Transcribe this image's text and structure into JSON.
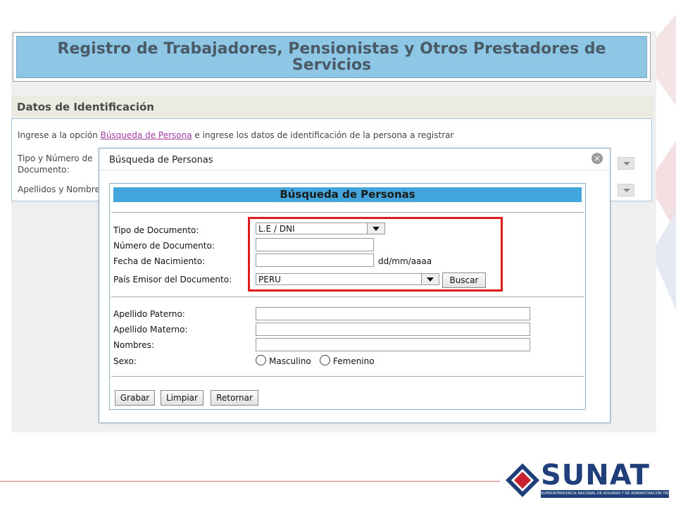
{
  "page": {
    "title": "Registro de Trabajadores, Pensionistas y Otros Prestadores de Servicios",
    "section_title": "Datos de Identificación",
    "intro_before": "Ingrese a la opción ",
    "intro_link": "Búsqueda de Persona",
    "intro_after": " e ingrese los datos de identificación de la persona a registrar",
    "label_tipo_numero": "Tipo y Número de Documento:",
    "label_apellidos": "Apellidos y Nombre"
  },
  "dialog": {
    "title": "Búsqueda de Personas",
    "header": "Búsqueda de Personas",
    "fields": {
      "tipo_label": "Tipo de Documento:",
      "tipo_value": "L.E / DNI",
      "numero_label": "Número de Documento:",
      "numero_value": "",
      "fecha_label": "Fecha de Nacimiento:",
      "fecha_value": "",
      "fecha_hint": "dd/mm/aaaa",
      "pais_label": "País Emisor del Documento:",
      "pais_value": "PERU",
      "buscar_label": "Buscar",
      "paterno_label": "Apellido Paterno:",
      "materno_label": "Apellido Materno:",
      "nombres_label": "Nombres:",
      "sexo_label": "Sexo:",
      "masculino_label": "Masculino",
      "femenino_label": "Femenino"
    },
    "buttons": {
      "grabar": "Grabar",
      "limpiar": "Limpiar",
      "retornar": "Retornar"
    }
  },
  "footer": {
    "logo_text": "SUNAT",
    "logo_tagline": "SUPERINTENDENCIA NACIONAL DE ADUANAS Y DE ADMINISTRACIÓN TRIBUTARIA"
  },
  "colors": {
    "title_bg": "#8ec6e6",
    "dialog_header_bg": "#42a6dc",
    "highlight": "#e01b1b",
    "brand_blue": "#1f3e7a",
    "brand_red": "#c8202f"
  }
}
